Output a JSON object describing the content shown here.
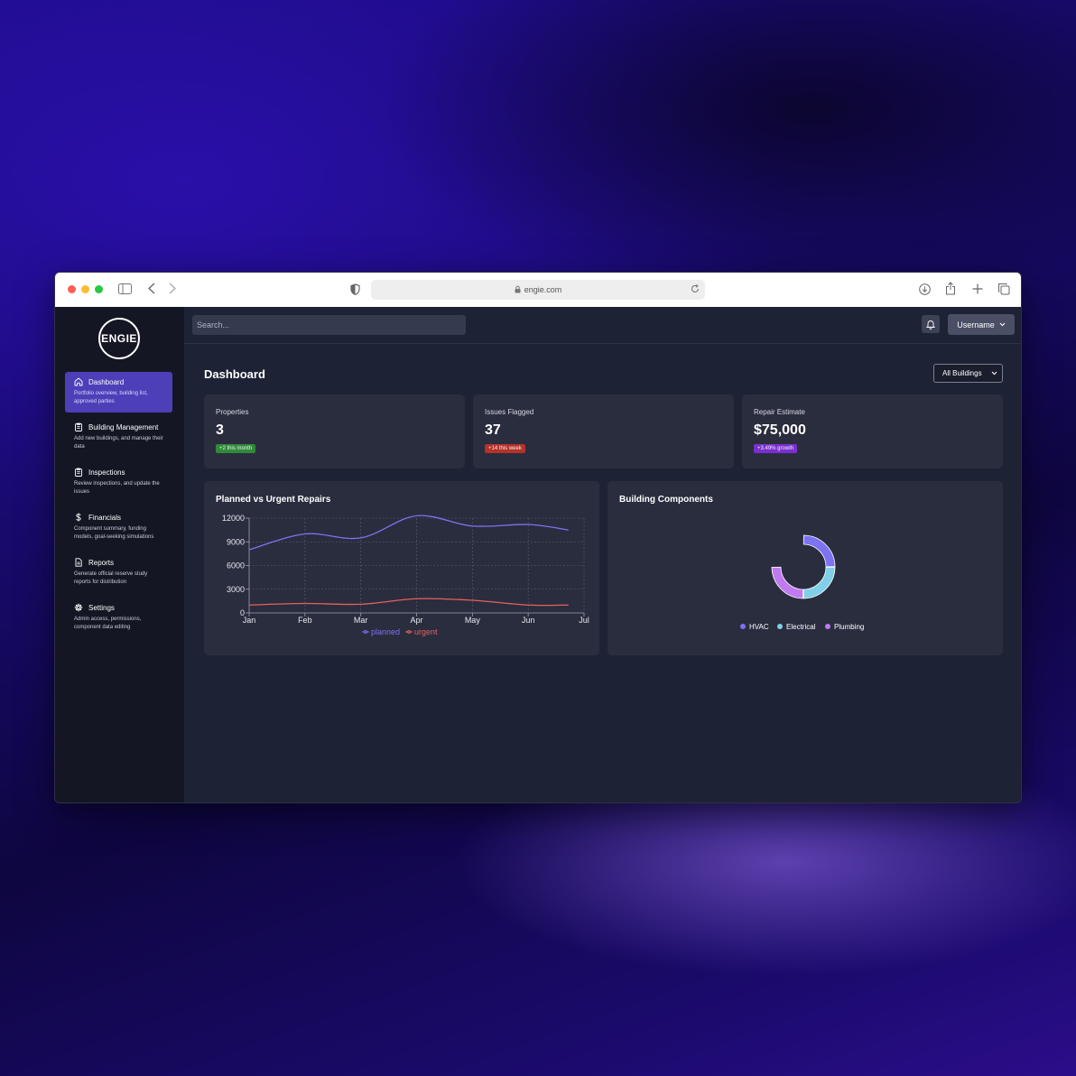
{
  "browser": {
    "url": "engie.com"
  },
  "sidebar": {
    "logo_text": "ENGIE",
    "items": [
      {
        "label": "Dashboard",
        "desc": "Portfolio overview, building list, approved parties",
        "icon": "home-icon"
      },
      {
        "label": "Building Management",
        "desc": "Add new buildings, and manage their data",
        "icon": "clipboard-icon"
      },
      {
        "label": "Inspections",
        "desc": "Review inspections, and update the issues",
        "icon": "clipboard-icon"
      },
      {
        "label": "Financials",
        "desc": "Component summary, funding models, goal-seeking simulations",
        "icon": "dollar-icon"
      },
      {
        "label": "Reports",
        "desc": "Generate official reserve study reports for distribution",
        "icon": "document-icon"
      },
      {
        "label": "Settings",
        "desc": "Admin access, permissions, component data editing",
        "icon": "gear-icon"
      }
    ]
  },
  "topbar": {
    "search_placeholder": "Search...",
    "username": "Username"
  },
  "main": {
    "title": "Dashboard",
    "building_filter": "All Buildings"
  },
  "stats": [
    {
      "label": "Properties",
      "value": "3",
      "badge": "+2 this month",
      "badge_color": "#2f8a3a"
    },
    {
      "label": "Issues Flagged",
      "value": "37",
      "badge": "+14 this week",
      "badge_color": "#b3322a"
    },
    {
      "label": "Repair Estimate",
      "value": "$75,000",
      "badge": "+3.49% growth",
      "badge_color": "#7a2fd0"
    }
  ],
  "colors": {
    "accent": "#4c3fb8",
    "planned": "#7d72f0",
    "urgent": "#e5615c",
    "hvac": "#7d72f0",
    "electrical": "#7fd0e8",
    "plumbing": "#c07af0"
  },
  "chart_data": [
    {
      "type": "line",
      "title": "Planned vs Urgent Repairs",
      "x": [
        "Jan",
        "Feb",
        "Mar",
        "Apr",
        "May",
        "Jun",
        "Jul"
      ],
      "ylim": [
        0,
        12000
      ],
      "yticks": [
        "0",
        "3000",
        "6000",
        "9000",
        "12000"
      ],
      "grid": true,
      "legend": "bottom",
      "series": [
        {
          "name": "planned",
          "values": [
            8000,
            10000,
            9500,
            12300,
            11000,
            11200,
            10500
          ]
        },
        {
          "name": "urgent",
          "values": [
            1000,
            1200,
            1100,
            1800,
            1600,
            1000,
            1000
          ]
        }
      ]
    },
    {
      "type": "pie",
      "title": "Building Components",
      "legend": "bottom",
      "series": [
        {
          "name": "HVAC",
          "value": 25
        },
        {
          "name": "Electrical",
          "value": 25
        },
        {
          "name": "Plumbing",
          "value": 25
        }
      ]
    }
  ]
}
